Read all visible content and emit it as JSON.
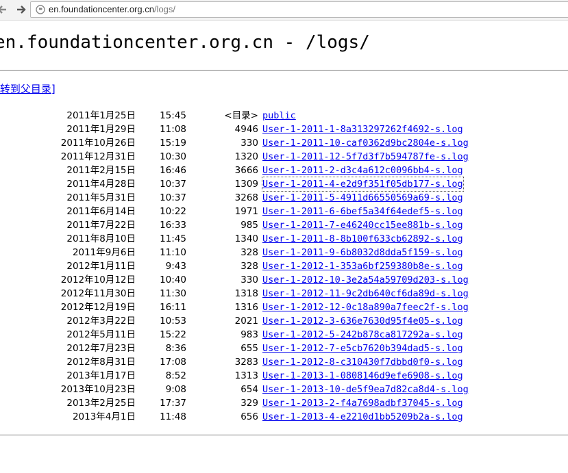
{
  "browser": {
    "url_host": "en.foundationcenter.org.cn",
    "url_path": "/logs/"
  },
  "page": {
    "title": "en.foundationcenter.org.cn - /logs/",
    "parent_link": "[转到父目录]"
  },
  "listing": [
    {
      "date": "2011年1月25日",
      "time": "15:45",
      "size": "<目录>",
      "name": "public"
    },
    {
      "date": "2011年1月29日",
      "time": "11:08",
      "size": "4946",
      "name": "User-1-2011-1-8a313297262f4692-s.log"
    },
    {
      "date": "2011年10月26日",
      "time": "15:19",
      "size": "330",
      "name": "User-1-2011-10-caf0362d9bc2804e-s.log"
    },
    {
      "date": "2011年12月31日",
      "time": "10:30",
      "size": "1320",
      "name": "User-1-2011-12-5f7d3f7b594787fe-s.log"
    },
    {
      "date": "2011年2月15日",
      "time": "16:46",
      "size": "3666",
      "name": "User-1-2011-2-d3c4a612c0096bb4-s.log"
    },
    {
      "date": "2011年4月28日",
      "time": "10:37",
      "size": "1309",
      "name": "User-1-2011-4-e2d9f351f05db177-s.log"
    },
    {
      "date": "2011年5月31日",
      "time": "10:37",
      "size": "3268",
      "name": "User-1-2011-5-4911d66550569a69-s.log"
    },
    {
      "date": "2011年6月14日",
      "time": "10:22",
      "size": "1971",
      "name": "User-1-2011-6-6bef5a34f64edef5-s.log"
    },
    {
      "date": "2011年7月22日",
      "time": "16:33",
      "size": "985",
      "name": "User-1-2011-7-e46240cc15ee881b-s.log"
    },
    {
      "date": "2011年8月10日",
      "time": "11:45",
      "size": "1340",
      "name": "User-1-2011-8-8b100f633cb62892-s.log"
    },
    {
      "date": "2011年9月6日",
      "time": "11:10",
      "size": "328",
      "name": "User-1-2011-9-6b8032d8dda5f159-s.log"
    },
    {
      "date": "2012年1月11日",
      "time": "9:43",
      "size": "328",
      "name": "User-1-2012-1-353a6bf259380b8e-s.log"
    },
    {
      "date": "2012年10月12日",
      "time": "10:40",
      "size": "330",
      "name": "User-1-2012-10-3e2a54a59709d203-s.log"
    },
    {
      "date": "2012年11月30日",
      "time": "11:30",
      "size": "1318",
      "name": "User-1-2012-11-9c2db640cf6da89d-s.log"
    },
    {
      "date": "2012年12月19日",
      "time": "16:11",
      "size": "1316",
      "name": "User-1-2012-12-0c18a890a7feec2f-s.log"
    },
    {
      "date": "2012年3月22日",
      "time": "10:53",
      "size": "2021",
      "name": "User-1-2012-3-636e7630d95f4e05-s.log"
    },
    {
      "date": "2012年5月11日",
      "time": "15:22",
      "size": "983",
      "name": "User-1-2012-5-242b878ca817292a-s.log"
    },
    {
      "date": "2012年7月23日",
      "time": "8:36",
      "size": "655",
      "name": "User-1-2012-7-e5cb7620b394dad5-s.log"
    },
    {
      "date": "2012年8月31日",
      "time": "17:08",
      "size": "3283",
      "name": "User-1-2012-8-c310430f7dbbd0f0-s.log"
    },
    {
      "date": "2013年1月17日",
      "time": "8:52",
      "size": "1313",
      "name": "User-1-2013-1-0808146d9efe6908-s.log"
    },
    {
      "date": "2013年10月23日",
      "time": "9:08",
      "size": "654",
      "name": "User-1-2013-10-de5f9ea7d82ca8d4-s.log"
    },
    {
      "date": "2013年2月25日",
      "time": "17:37",
      "size": "329",
      "name": "User-1-2013-2-f4a7698adbf37045-s.log"
    },
    {
      "date": "2013年4月1日",
      "time": "11:48",
      "size": "656",
      "name": "User-1-2013-4-e2210d1bb5209b2a-s.log"
    }
  ],
  "focused_entry": "User-1-2011-4-e2d9f351f05db177-s.log",
  "icons": {
    "back": "back-arrow-icon",
    "forward": "forward-arrow-icon",
    "page": "globe-page-icon"
  },
  "colors": {
    "link": "#0000ee",
    "chrome": "#f3f3f3"
  }
}
